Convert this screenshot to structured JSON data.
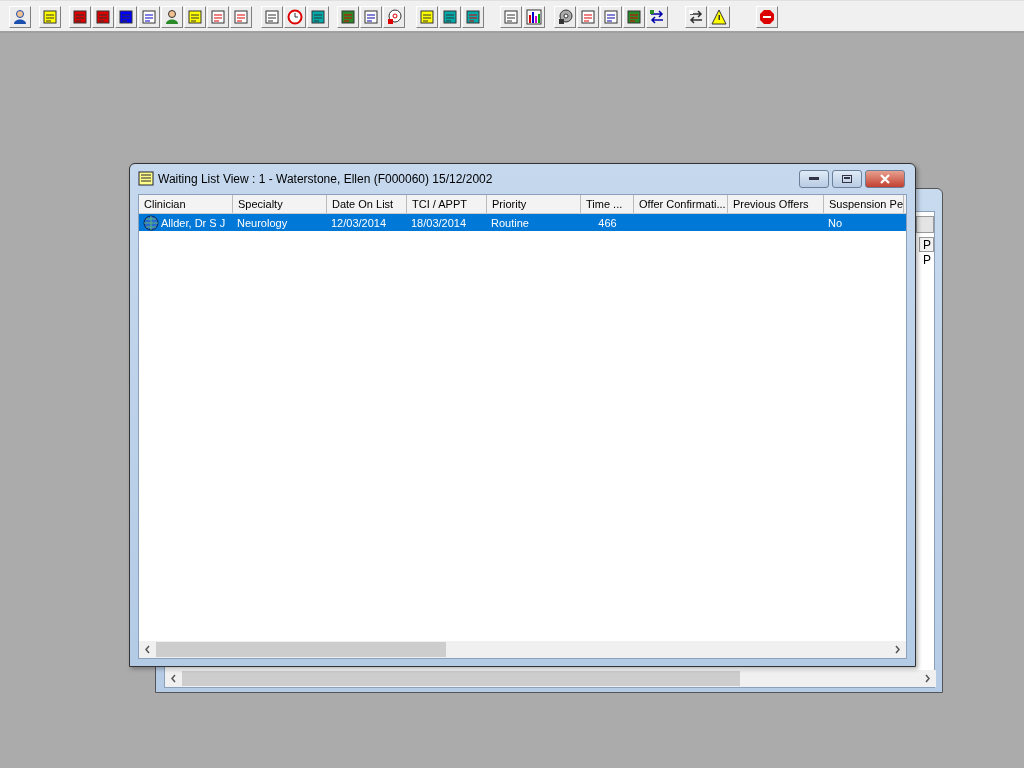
{
  "back_window": {
    "column_header": "P",
    "cell": "P"
  },
  "window": {
    "title": "Waiting List View :  1 - Waterstone, Ellen (F000060) 15/12/2002"
  },
  "table": {
    "columns": [
      "Clinician",
      "Specialty",
      "Date On List",
      "TCI / APPT",
      "Priority",
      "Time ...",
      "Offer Confirmati...",
      "Previous Offers",
      "Suspension Pe"
    ],
    "rows": [
      {
        "selected": true,
        "cells": [
          "Allder, Dr S J",
          "Neurology",
          "12/03/2014",
          "18/03/2014",
          "Routine",
          "466",
          "",
          "",
          "No"
        ]
      }
    ]
  }
}
